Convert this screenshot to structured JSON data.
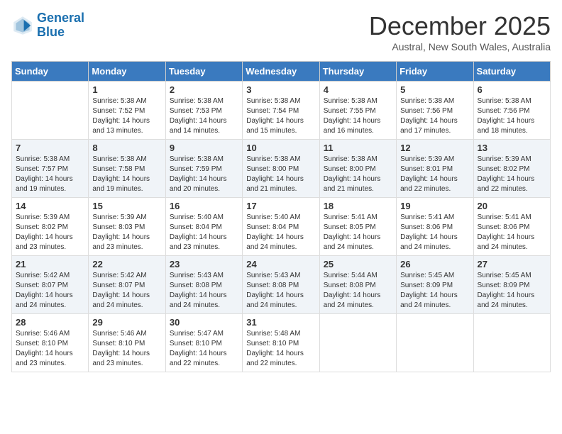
{
  "logo": {
    "line1": "General",
    "line2": "Blue"
  },
  "title": "December 2025",
  "subtitle": "Austral, New South Wales, Australia",
  "days_of_week": [
    "Sunday",
    "Monday",
    "Tuesday",
    "Wednesday",
    "Thursday",
    "Friday",
    "Saturday"
  ],
  "weeks": [
    [
      {
        "day": "",
        "sunrise": "",
        "sunset": "",
        "daylight": ""
      },
      {
        "day": "1",
        "sunrise": "Sunrise: 5:38 AM",
        "sunset": "Sunset: 7:52 PM",
        "daylight": "Daylight: 14 hours and 13 minutes."
      },
      {
        "day": "2",
        "sunrise": "Sunrise: 5:38 AM",
        "sunset": "Sunset: 7:53 PM",
        "daylight": "Daylight: 14 hours and 14 minutes."
      },
      {
        "day": "3",
        "sunrise": "Sunrise: 5:38 AM",
        "sunset": "Sunset: 7:54 PM",
        "daylight": "Daylight: 14 hours and 15 minutes."
      },
      {
        "day": "4",
        "sunrise": "Sunrise: 5:38 AM",
        "sunset": "Sunset: 7:55 PM",
        "daylight": "Daylight: 14 hours and 16 minutes."
      },
      {
        "day": "5",
        "sunrise": "Sunrise: 5:38 AM",
        "sunset": "Sunset: 7:56 PM",
        "daylight": "Daylight: 14 hours and 17 minutes."
      },
      {
        "day": "6",
        "sunrise": "Sunrise: 5:38 AM",
        "sunset": "Sunset: 7:56 PM",
        "daylight": "Daylight: 14 hours and 18 minutes."
      }
    ],
    [
      {
        "day": "7",
        "sunrise": "Sunrise: 5:38 AM",
        "sunset": "Sunset: 7:57 PM",
        "daylight": "Daylight: 14 hours and 19 minutes."
      },
      {
        "day": "8",
        "sunrise": "Sunrise: 5:38 AM",
        "sunset": "Sunset: 7:58 PM",
        "daylight": "Daylight: 14 hours and 19 minutes."
      },
      {
        "day": "9",
        "sunrise": "Sunrise: 5:38 AM",
        "sunset": "Sunset: 7:59 PM",
        "daylight": "Daylight: 14 hours and 20 minutes."
      },
      {
        "day": "10",
        "sunrise": "Sunrise: 5:38 AM",
        "sunset": "Sunset: 8:00 PM",
        "daylight": "Daylight: 14 hours and 21 minutes."
      },
      {
        "day": "11",
        "sunrise": "Sunrise: 5:38 AM",
        "sunset": "Sunset: 8:00 PM",
        "daylight": "Daylight: 14 hours and 21 minutes."
      },
      {
        "day": "12",
        "sunrise": "Sunrise: 5:39 AM",
        "sunset": "Sunset: 8:01 PM",
        "daylight": "Daylight: 14 hours and 22 minutes."
      },
      {
        "day": "13",
        "sunrise": "Sunrise: 5:39 AM",
        "sunset": "Sunset: 8:02 PM",
        "daylight": "Daylight: 14 hours and 22 minutes."
      }
    ],
    [
      {
        "day": "14",
        "sunrise": "Sunrise: 5:39 AM",
        "sunset": "Sunset: 8:02 PM",
        "daylight": "Daylight: 14 hours and 23 minutes."
      },
      {
        "day": "15",
        "sunrise": "Sunrise: 5:39 AM",
        "sunset": "Sunset: 8:03 PM",
        "daylight": "Daylight: 14 hours and 23 minutes."
      },
      {
        "day": "16",
        "sunrise": "Sunrise: 5:40 AM",
        "sunset": "Sunset: 8:04 PM",
        "daylight": "Daylight: 14 hours and 23 minutes."
      },
      {
        "day": "17",
        "sunrise": "Sunrise: 5:40 AM",
        "sunset": "Sunset: 8:04 PM",
        "daylight": "Daylight: 14 hours and 24 minutes."
      },
      {
        "day": "18",
        "sunrise": "Sunrise: 5:41 AM",
        "sunset": "Sunset: 8:05 PM",
        "daylight": "Daylight: 14 hours and 24 minutes."
      },
      {
        "day": "19",
        "sunrise": "Sunrise: 5:41 AM",
        "sunset": "Sunset: 8:06 PM",
        "daylight": "Daylight: 14 hours and 24 minutes."
      },
      {
        "day": "20",
        "sunrise": "Sunrise: 5:41 AM",
        "sunset": "Sunset: 8:06 PM",
        "daylight": "Daylight: 14 hours and 24 minutes."
      }
    ],
    [
      {
        "day": "21",
        "sunrise": "Sunrise: 5:42 AM",
        "sunset": "Sunset: 8:07 PM",
        "daylight": "Daylight: 14 hours and 24 minutes."
      },
      {
        "day": "22",
        "sunrise": "Sunrise: 5:42 AM",
        "sunset": "Sunset: 8:07 PM",
        "daylight": "Daylight: 14 hours and 24 minutes."
      },
      {
        "day": "23",
        "sunrise": "Sunrise: 5:43 AM",
        "sunset": "Sunset: 8:08 PM",
        "daylight": "Daylight: 14 hours and 24 minutes."
      },
      {
        "day": "24",
        "sunrise": "Sunrise: 5:43 AM",
        "sunset": "Sunset: 8:08 PM",
        "daylight": "Daylight: 14 hours and 24 minutes."
      },
      {
        "day": "25",
        "sunrise": "Sunrise: 5:44 AM",
        "sunset": "Sunset: 8:08 PM",
        "daylight": "Daylight: 14 hours and 24 minutes."
      },
      {
        "day": "26",
        "sunrise": "Sunrise: 5:45 AM",
        "sunset": "Sunset: 8:09 PM",
        "daylight": "Daylight: 14 hours and 24 minutes."
      },
      {
        "day": "27",
        "sunrise": "Sunrise: 5:45 AM",
        "sunset": "Sunset: 8:09 PM",
        "daylight": "Daylight: 14 hours and 24 minutes."
      }
    ],
    [
      {
        "day": "28",
        "sunrise": "Sunrise: 5:46 AM",
        "sunset": "Sunset: 8:10 PM",
        "daylight": "Daylight: 14 hours and 23 minutes."
      },
      {
        "day": "29",
        "sunrise": "Sunrise: 5:46 AM",
        "sunset": "Sunset: 8:10 PM",
        "daylight": "Daylight: 14 hours and 23 minutes."
      },
      {
        "day": "30",
        "sunrise": "Sunrise: 5:47 AM",
        "sunset": "Sunset: 8:10 PM",
        "daylight": "Daylight: 14 hours and 22 minutes."
      },
      {
        "day": "31",
        "sunrise": "Sunrise: 5:48 AM",
        "sunset": "Sunset: 8:10 PM",
        "daylight": "Daylight: 14 hours and 22 minutes."
      },
      {
        "day": "",
        "sunrise": "",
        "sunset": "",
        "daylight": ""
      },
      {
        "day": "",
        "sunrise": "",
        "sunset": "",
        "daylight": ""
      },
      {
        "day": "",
        "sunrise": "",
        "sunset": "",
        "daylight": ""
      }
    ]
  ]
}
